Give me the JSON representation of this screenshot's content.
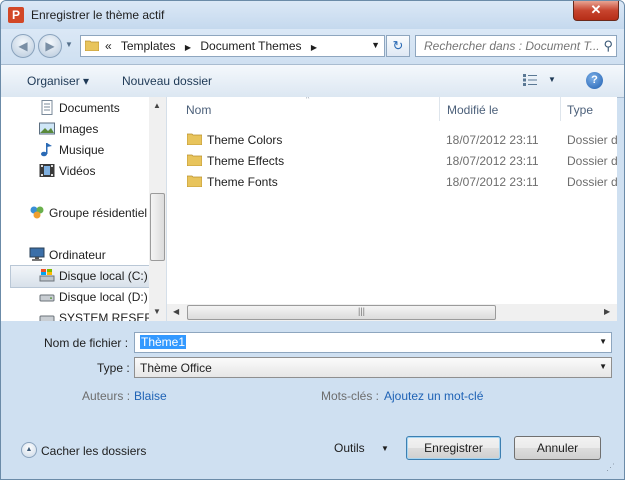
{
  "window": {
    "title": "Enregistrer le thème actif",
    "app_icon_letter": "P",
    "close_label": "✕"
  },
  "navbar": {
    "back_glyph": "◀",
    "forward_glyph": "▶",
    "history_glyph": "▼",
    "breadcrumb_prefix": "«",
    "breadcrumbs": [
      "Templates",
      "Document Themes"
    ],
    "separator": "▶",
    "dropdown_glyph": "▼",
    "refresh_glyph": "↻",
    "search_placeholder": "Rechercher dans : Document T..."
  },
  "toolbar": {
    "organize_label": "Organiser ▾",
    "new_folder_label": "Nouveau dossier",
    "view_dropdown": "▼",
    "help_label": "?"
  },
  "nav_pane": {
    "items": [
      {
        "label": "Documents",
        "icon": "documents-icon"
      },
      {
        "label": "Images",
        "icon": "images-icon"
      },
      {
        "label": "Musique",
        "icon": "music-icon"
      },
      {
        "label": "Vidéos",
        "icon": "videos-icon"
      },
      {
        "label": "Groupe résidentiel",
        "icon": "homegroup-icon"
      },
      {
        "label": "Ordinateur",
        "icon": "computer-icon"
      },
      {
        "label": "Disque local (C:)",
        "icon": "drive-c-icon"
      },
      {
        "label": "Disque local (D:)",
        "icon": "drive-d-icon"
      },
      {
        "label": "SYSTEM RESERVE",
        "icon": "drive-system-icon"
      }
    ],
    "selected": "Disque local (C:)",
    "scroll_up": "▲",
    "scroll_down": "▼"
  },
  "file_list": {
    "columns": [
      "Nom",
      "Modifié le",
      "Type"
    ],
    "sort_glyph": "^",
    "rows": [
      {
        "name": "Theme Colors",
        "modified": "18/07/2012 23:11",
        "type": "Dossier de fichiers"
      },
      {
        "name": "Theme Effects",
        "modified": "18/07/2012 23:11",
        "type": "Dossier de fichiers"
      },
      {
        "name": "Theme Fonts",
        "modified": "18/07/2012 23:11",
        "type": "Dossier de fichiers"
      }
    ],
    "scroll_left": "◀",
    "scroll_right": "▶",
    "grip": "|||"
  },
  "form": {
    "filename_label": "Nom de fichier :",
    "filename_value": "Thème1",
    "type_label": "Type :",
    "type_value": "Thème Office",
    "authors_label": "Auteurs :",
    "authors_value": "Blaise",
    "keywords_label": "Mots-clés :",
    "keywords_value": "Ajoutez un mot-clé",
    "dropdown_glyph": "▼"
  },
  "footer": {
    "hide_folders_label": "Cacher les dossiers",
    "hide_folders_glyph": "▲",
    "tools_label": "Outils",
    "tools_dropdown": "▼",
    "save_label": "Enregistrer",
    "cancel_label": "Annuler"
  },
  "colors": {
    "accent": "#3399ff",
    "link": "#1e62b5",
    "close": "#c7442e"
  }
}
